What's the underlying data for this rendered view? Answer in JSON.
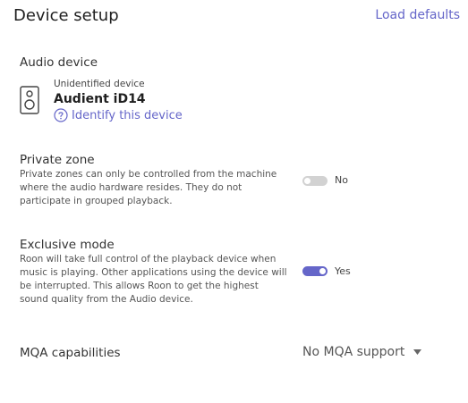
{
  "header": {
    "title": "Device setup",
    "load_defaults": "Load defaults"
  },
  "audio_device": {
    "label": "Audio device",
    "icon": "speaker-icon",
    "subtitle": "Unidentified device",
    "name": "Audient iD14",
    "identify_icon": "question-circle-icon",
    "identify_link": "Identify this device"
  },
  "private_zone": {
    "label": "Private zone",
    "description_lines": [
      "Private zones can only be controlled from the machine",
      "where the audio hardware resides. They do not",
      "participate in grouped playback."
    ],
    "enabled": false,
    "value_text": "No"
  },
  "exclusive_mode": {
    "label": "Exclusive mode",
    "description_lines": [
      "Roon will take full control of the playback device when",
      "music is playing. Other applications using the device will",
      "be interrupted. This allows Roon to get the highest",
      "sound quality from the Audio device."
    ],
    "enabled": true,
    "value_text": "Yes"
  },
  "mqa": {
    "label": "MQA capabilities",
    "selected": "No MQA support",
    "icon": "caret-down-icon"
  },
  "colors": {
    "accent": "#6566c9",
    "toggle_off": "#d2d2d2"
  }
}
